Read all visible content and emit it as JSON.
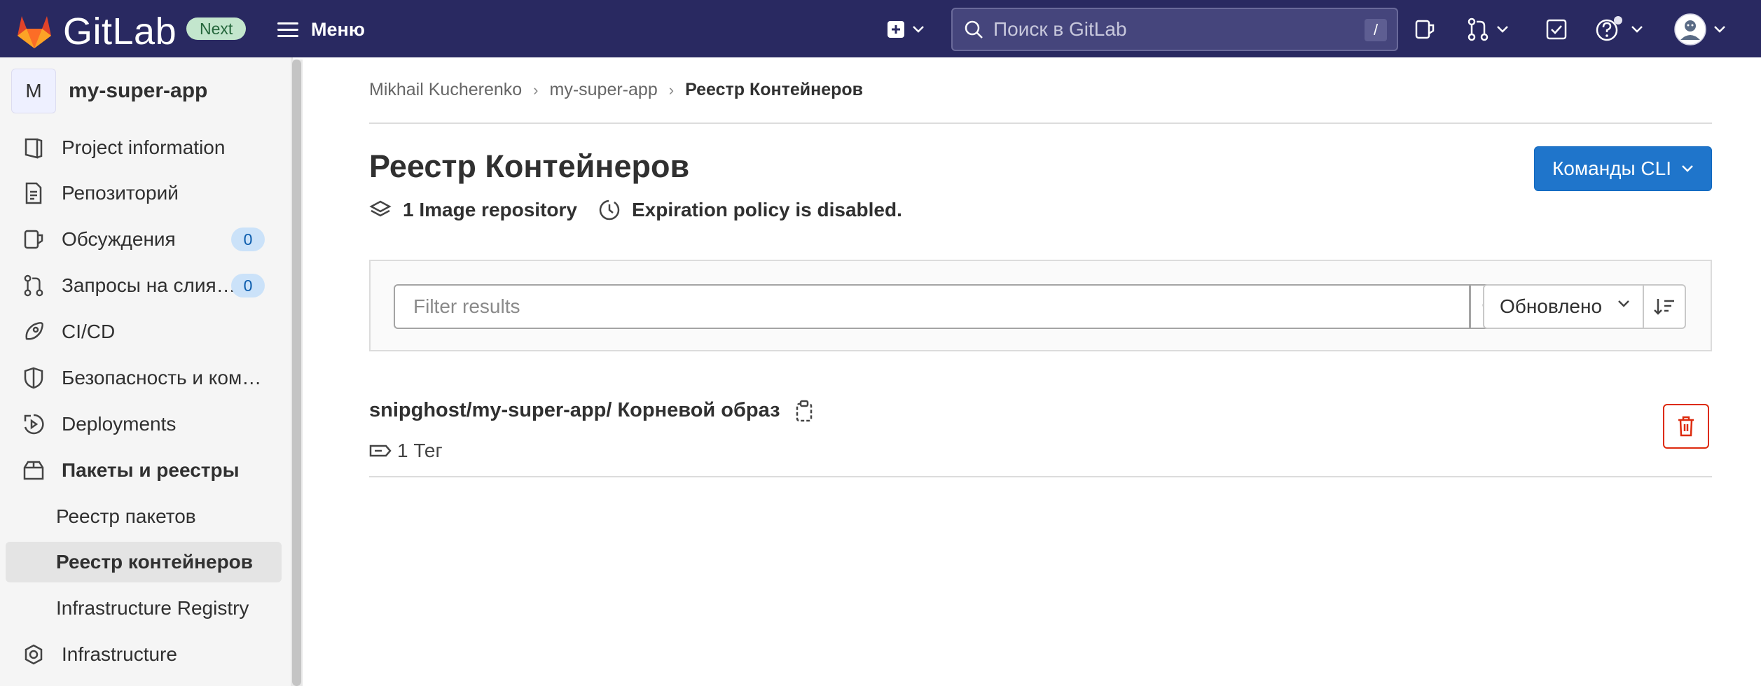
{
  "topbar": {
    "brand": "GitLab",
    "badge": "Next",
    "menu_label": "Меню",
    "search_placeholder": "Поиск в GitLab",
    "search_shortcut": "/",
    "colors": {
      "background": "#292961",
      "logo_orange": "#e24329"
    }
  },
  "sidebar": {
    "project_avatar_letter": "M",
    "project_name": "my-super-app",
    "items": [
      {
        "label": "Project information",
        "icon": "project-info-icon"
      },
      {
        "label": "Репозиторий",
        "icon": "document-icon"
      },
      {
        "label": "Обсуждения",
        "icon": "issues-icon",
        "count": "0"
      },
      {
        "label": "Запросы на слия…",
        "icon": "merge-request-icon",
        "count": "0"
      },
      {
        "label": "CI/CD",
        "icon": "rocket-icon"
      },
      {
        "label": "Безопасность и ком…",
        "icon": "shield-icon"
      },
      {
        "label": "Deployments",
        "icon": "deployments-icon"
      },
      {
        "label": "Пакеты и реестры",
        "icon": "package-icon"
      },
      {
        "label": "Реестр пакетов"
      },
      {
        "label": "Реестр контейнеров"
      },
      {
        "label": "Infrastructure Registry"
      },
      {
        "label": "Infrastructure",
        "icon": "cloud-gear-icon"
      }
    ]
  },
  "breadcrumb": {
    "items": [
      "Mikhail Kucherenko",
      "my-super-app",
      "Реестр Контейнеров"
    ]
  },
  "page": {
    "title": "Реестр Контейнеров",
    "cli_button": "Команды CLI",
    "image_repo_count": "1 Image repository",
    "expiration": "Expiration policy is disabled."
  },
  "filter": {
    "placeholder": "Filter results",
    "sort_label": "Обновлено"
  },
  "repos": [
    {
      "name": "snipghost/my-super-app/ Корневой образ",
      "tags": "1 Тег"
    }
  ],
  "colors": {
    "primary_button": "#1f75cb",
    "danger": "#dd2b0e",
    "badge_bg": "#cbe2f9",
    "badge_text": "#0b5cad"
  }
}
